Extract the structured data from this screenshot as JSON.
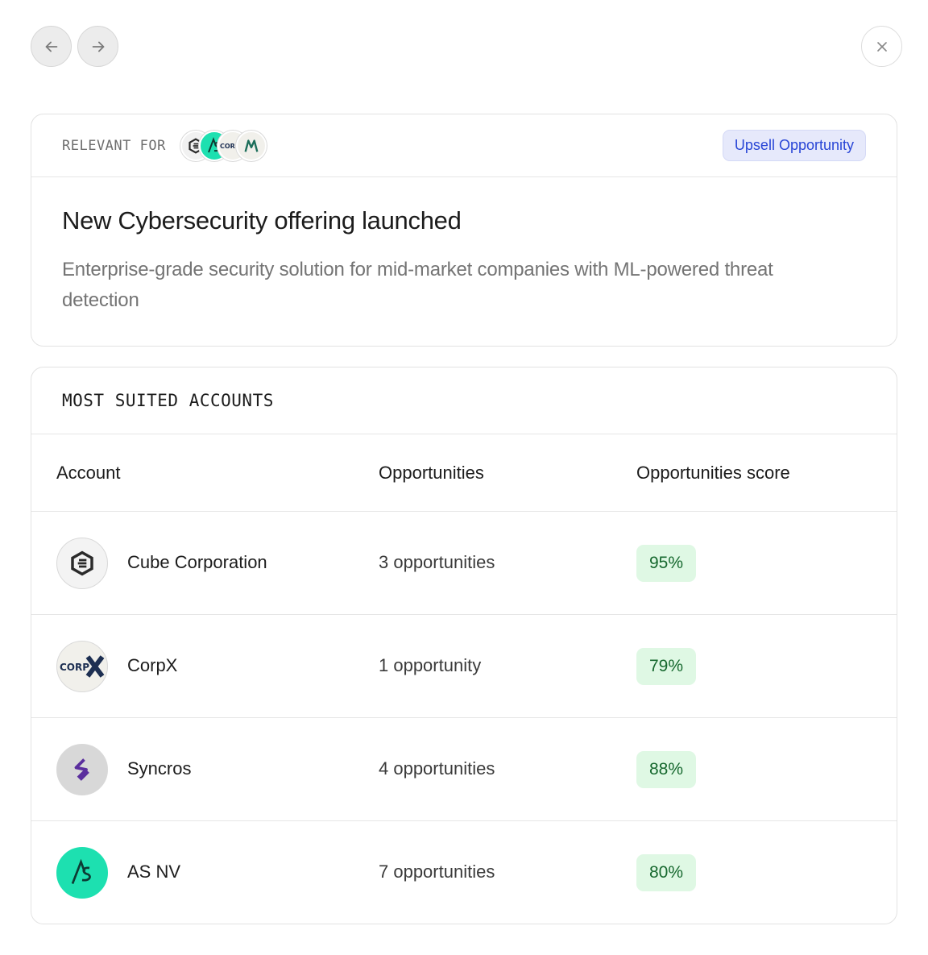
{
  "header_relevant_label": "RELEVANT FOR",
  "tag": "Upsell Opportunity",
  "title": "New Cybersecurity offering launched",
  "description": "Enterprise-grade security solution for mid-market companies with ML-powered threat detection",
  "section_title": "MOST SUITED ACCOUNTS",
  "columns": [
    "Account",
    "Opportunities",
    "Opportunities score"
  ],
  "rows": [
    {
      "name": "Cube Corporation",
      "opportunities": "3 opportunities",
      "score": "95%",
      "logo": "cube-logo-icon"
    },
    {
      "name": "CorpX",
      "opportunities": "1 opportunity",
      "score": "79%",
      "logo": "corpx-logo-icon"
    },
    {
      "name": "Syncros",
      "opportunities": "4 opportunities",
      "score": "88%",
      "logo": "syncros-logo-icon"
    },
    {
      "name": "AS NV",
      "opportunities": "7 opportunities",
      "score": "80%",
      "logo": "asnv-logo-icon"
    }
  ],
  "colors": {
    "tag_bg": "#e6e9fb",
    "tag_text": "#2946d6",
    "score_bg": "#dff8e4",
    "score_text": "#16682e",
    "asnv_brand": "#1de0b0"
  }
}
